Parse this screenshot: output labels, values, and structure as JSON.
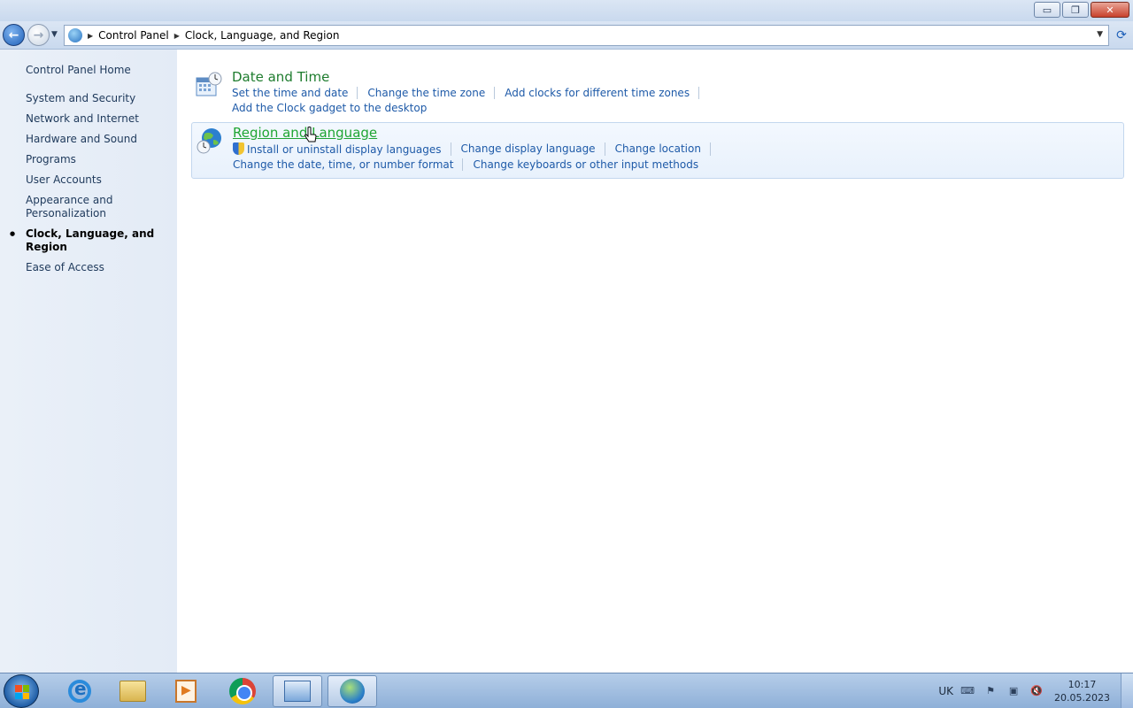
{
  "window": {
    "controls": {
      "minimize": "▭",
      "maximize": "❐",
      "close": "✕"
    }
  },
  "address_bar": {
    "crumbs": [
      "Control Panel",
      "Clock, Language, and Region"
    ]
  },
  "left_pane": {
    "home": "Control Panel Home",
    "items": [
      {
        "label": "System and Security",
        "active": false
      },
      {
        "label": "Network and Internet",
        "active": false
      },
      {
        "label": "Hardware and Sound",
        "active": false
      },
      {
        "label": "Programs",
        "active": false
      },
      {
        "label": "User Accounts",
        "active": false
      },
      {
        "label": "Appearance and Personalization",
        "active": false
      },
      {
        "label": "Clock, Language, and Region",
        "active": true
      },
      {
        "label": "Ease of Access",
        "active": false
      }
    ]
  },
  "categories": [
    {
      "title": "Date and Time",
      "icon": "calendar-clock-icon",
      "links_row1": [
        "Set the time and date",
        "Change the time zone",
        "Add clocks for different time zones"
      ],
      "links_row2": [
        "Add the Clock gadget to the desktop"
      ]
    },
    {
      "title": "Region and Language",
      "icon": "globe-clock-icon",
      "links_row1": [
        "Install or uninstall display languages",
        "Change display language",
        "Change location"
      ],
      "links_row2": [
        "Change the date, time, or number format",
        "Change keyboards or other input methods"
      ]
    }
  ],
  "taskbar": {
    "apps": [
      "internet-explorer-icon",
      "file-explorer-icon",
      "media-player-icon",
      "chrome-icon",
      "control-panel-icon",
      "region-language-icon"
    ],
    "tray": {
      "language": "UK",
      "time": "10:17",
      "date": "20.05.2023"
    }
  },
  "colors": {
    "link": "#1e5aa8",
    "category_title": "#1e7c2e",
    "hover_title": "#1fa533",
    "left_pane_bg": "#e3ebf6"
  }
}
